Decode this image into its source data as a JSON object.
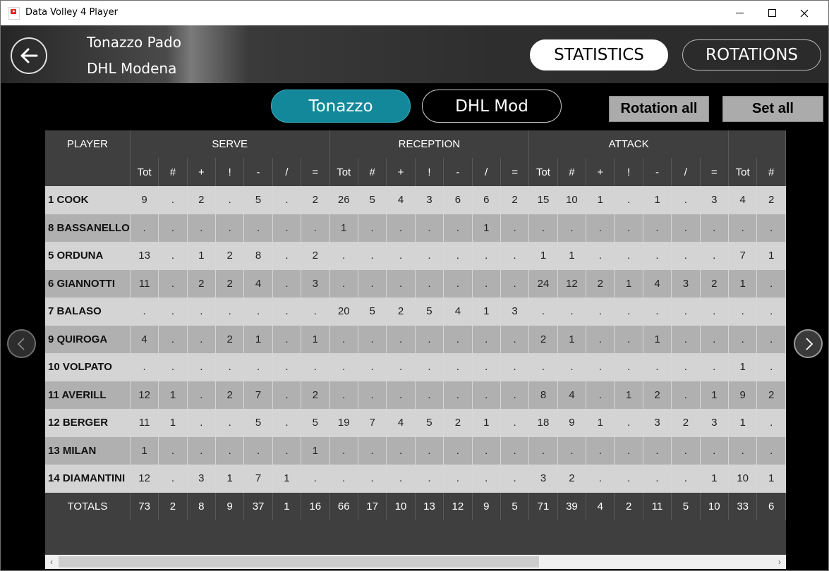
{
  "window": {
    "title": "Data Volley 4 Player"
  },
  "header": {
    "team_line_1": "Tonazzo Pado",
    "team_line_2": "DHL Modena",
    "statistics_label": "STATISTICS",
    "rotations_label": "ROTATIONS"
  },
  "team_tabs": {
    "home": "Tonazzo",
    "away": "DHL Mod"
  },
  "filters": {
    "rotation": "Rotation all",
    "set": "Set all"
  },
  "colors": {
    "active_tab": "#13889a",
    "row_light": "#d4d4d4",
    "row_dark": "#b0b0b0",
    "header_bg": "#3f3f3f"
  },
  "icons": {
    "back": "arrow-left-icon",
    "prev": "chevron-left-icon",
    "next": "chevron-right-icon"
  },
  "table": {
    "player_header": "PLAYER",
    "groups": [
      "SERVE",
      "RECEPTION",
      "ATTACK"
    ],
    "subheaders": [
      "Tot",
      "#",
      "+",
      "!",
      "-",
      "/",
      "=",
      "Tot",
      "#",
      "+",
      "!",
      "-",
      "/",
      "=",
      "Tot",
      "#",
      "+",
      "!",
      "-",
      "/",
      "=",
      "Tot",
      "#"
    ],
    "rows": [
      {
        "player": "1 COOK",
        "values": [
          "9",
          ".",
          "2",
          ".",
          "5",
          ".",
          "2",
          "26",
          "5",
          "4",
          "3",
          "6",
          "6",
          "2",
          "15",
          "10",
          "1",
          ".",
          "1",
          ".",
          "3",
          "4",
          "2"
        ]
      },
      {
        "player": "8 BASSANELLO",
        "values": [
          ".",
          ".",
          ".",
          ".",
          ".",
          ".",
          ".",
          "1",
          ".",
          ".",
          ".",
          ".",
          "1",
          ".",
          ".",
          ".",
          ".",
          ".",
          ".",
          ".",
          ".",
          ".",
          "."
        ]
      },
      {
        "player": "5 ORDUNA",
        "values": [
          "13",
          ".",
          "1",
          "2",
          "8",
          ".",
          "2",
          ".",
          ".",
          ".",
          ".",
          ".",
          ".",
          ".",
          "1",
          "1",
          ".",
          ".",
          ".",
          ".",
          ".",
          "7",
          "1"
        ]
      },
      {
        "player": "6 GIANNOTTI",
        "values": [
          "11",
          ".",
          "2",
          "2",
          "4",
          ".",
          "3",
          ".",
          ".",
          ".",
          ".",
          ".",
          ".",
          ".",
          "24",
          "12",
          "2",
          "1",
          "4",
          "3",
          "2",
          "1",
          "."
        ]
      },
      {
        "player": "7 BALASO",
        "values": [
          ".",
          ".",
          ".",
          ".",
          ".",
          ".",
          ".",
          "20",
          "5",
          "2",
          "5",
          "4",
          "1",
          "3",
          ".",
          ".",
          ".",
          ".",
          ".",
          ".",
          ".",
          ".",
          "."
        ]
      },
      {
        "player": "9 QUIROGA",
        "values": [
          "4",
          ".",
          ".",
          "2",
          "1",
          ".",
          "1",
          ".",
          ".",
          ".",
          ".",
          ".",
          ".",
          ".",
          "2",
          "1",
          ".",
          ".",
          "1",
          ".",
          ".",
          ".",
          "."
        ]
      },
      {
        "player": "10 VOLPATO",
        "values": [
          ".",
          ".",
          ".",
          ".",
          ".",
          ".",
          ".",
          ".",
          ".",
          ".",
          ".",
          ".",
          ".",
          ".",
          ".",
          ".",
          ".",
          ".",
          ".",
          ".",
          ".",
          "1",
          "."
        ]
      },
      {
        "player": "11 AVERILL",
        "values": [
          "12",
          "1",
          ".",
          "2",
          "7",
          ".",
          "2",
          ".",
          ".",
          ".",
          ".",
          ".",
          ".",
          ".",
          "8",
          "4",
          ".",
          "1",
          "2",
          ".",
          "1",
          "9",
          "2"
        ]
      },
      {
        "player": "12 BERGER",
        "values": [
          "11",
          "1",
          ".",
          ".",
          "5",
          ".",
          "5",
          "19",
          "7",
          "4",
          "5",
          "2",
          "1",
          ".",
          "18",
          "9",
          "1",
          ".",
          "3",
          "2",
          "3",
          "1",
          "."
        ]
      },
      {
        "player": "13 MILAN",
        "values": [
          "1",
          ".",
          ".",
          ".",
          ".",
          ".",
          "1",
          ".",
          ".",
          ".",
          ".",
          ".",
          ".",
          ".",
          ".",
          ".",
          ".",
          ".",
          ".",
          ".",
          ".",
          ".",
          "."
        ]
      },
      {
        "player": "14 DIAMANTINI",
        "values": [
          "12",
          ".",
          "3",
          "1",
          "7",
          "1",
          ".",
          ".",
          ".",
          ".",
          ".",
          ".",
          ".",
          ".",
          "3",
          "2",
          ".",
          ".",
          ".",
          ".",
          "1",
          "10",
          "1"
        ]
      }
    ],
    "totals": {
      "label": "TOTALS",
      "values": [
        "73",
        "2",
        "8",
        "9",
        "37",
        "1",
        "16",
        "66",
        "17",
        "10",
        "13",
        "12",
        "9",
        "5",
        "71",
        "39",
        "4",
        "2",
        "11",
        "5",
        "10",
        "33",
        "6"
      ]
    }
  }
}
